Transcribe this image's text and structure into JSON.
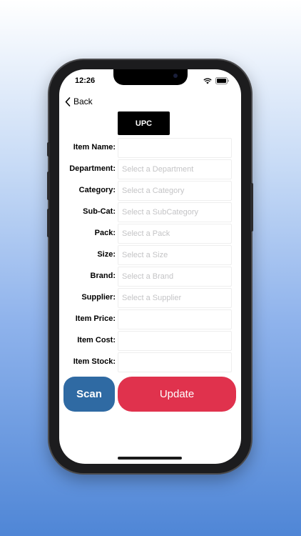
{
  "status_bar": {
    "time": "12:26"
  },
  "nav": {
    "back_label": "Back"
  },
  "upc_button": {
    "label": "UPC"
  },
  "form": {
    "fields": [
      {
        "label": "Item Name:",
        "placeholder": ""
      },
      {
        "label": "Department:",
        "placeholder": "Select a Department"
      },
      {
        "label": "Category:",
        "placeholder": "Select a Category"
      },
      {
        "label": "Sub-Cat:",
        "placeholder": "Select a SubCategory"
      },
      {
        "label": "Pack:",
        "placeholder": "Select a Pack"
      },
      {
        "label": "Size:",
        "placeholder": "Select a Size"
      },
      {
        "label": "Brand:",
        "placeholder": "Select a Brand"
      },
      {
        "label": "Supplier:",
        "placeholder": "Select a Supplier"
      },
      {
        "label": "Item Price:",
        "placeholder": ""
      },
      {
        "label": "Item Cost:",
        "placeholder": ""
      },
      {
        "label": "Item Stock:",
        "placeholder": ""
      }
    ]
  },
  "actions": {
    "scan_label": "Scan",
    "update_label": "Update"
  },
  "colors": {
    "scan": "#2f6aa3",
    "update": "#e0324d",
    "upc": "#000000"
  }
}
